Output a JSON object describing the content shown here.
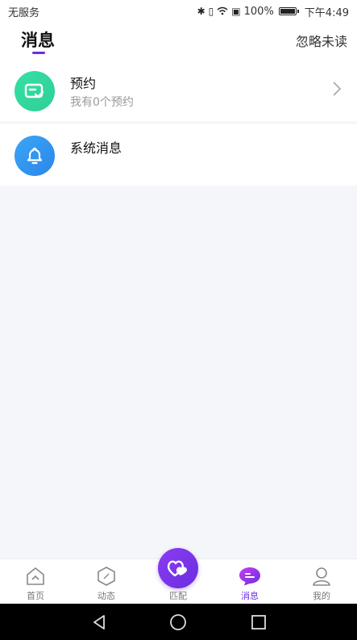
{
  "status_bar": {
    "carrier": "无服务",
    "battery": "100%",
    "time": "下午4:49"
  },
  "header": {
    "title": "消息",
    "ignore_unread": "忽略未读"
  },
  "messages": [
    {
      "title": "预约",
      "subtitle": "我有0个预约",
      "icon": "appointment-icon"
    },
    {
      "title": "系统消息",
      "subtitle": "",
      "icon": "bell-icon"
    }
  ],
  "bottom_nav": {
    "items": [
      {
        "label": "首页",
        "icon": "home-icon",
        "active": false
      },
      {
        "label": "动态",
        "icon": "compass-icon",
        "active": false
      },
      {
        "label": "匹配",
        "icon": "hearts-icon",
        "active": false
      },
      {
        "label": "消息",
        "icon": "chat-icon",
        "active": true
      },
      {
        "label": "我的",
        "icon": "user-icon",
        "active": false
      }
    ]
  },
  "colors": {
    "accent": "#6a2ee0",
    "appointment": "#35e0a6",
    "system": "#2b86ea"
  }
}
